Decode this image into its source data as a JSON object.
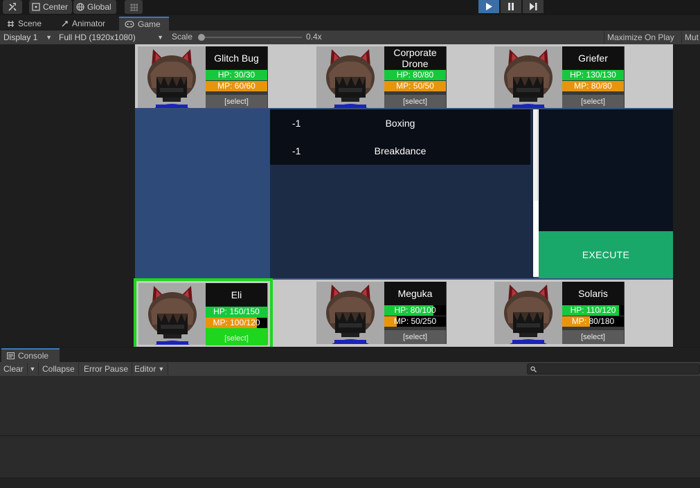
{
  "toolbar": {
    "center_label": "Center",
    "global_label": "Global"
  },
  "tabs": [
    {
      "label": "Scene"
    },
    {
      "label": "Animator"
    },
    {
      "label": "Game"
    }
  ],
  "gamebar": {
    "display": "Display 1",
    "resolution": "Full HD (1920x1080)",
    "scale_label": "Scale",
    "scale_value": "0.4x",
    "maximize": "Maximize On Play",
    "mute": "Mut"
  },
  "enemies": [
    {
      "name": "Glitch Bug",
      "hp": "HP: 30/30",
      "mp": "MP: 60/60",
      "hp_fill": 1.0,
      "mp_fill": 1.0,
      "select": "[select]"
    },
    {
      "name": "Corporate Drone",
      "hp": "HP: 80/80",
      "mp": "MP: 50/50",
      "hp_fill": 1.0,
      "mp_fill": 1.0,
      "select": "[select]"
    },
    {
      "name": "Griefer",
      "hp": "HP: 130/130",
      "mp": "MP: 80/80",
      "hp_fill": 1.0,
      "mp_fill": 1.0,
      "select": "[select]"
    }
  ],
  "players": [
    {
      "name": "Eli",
      "hp": "HP: 150/150",
      "mp": "MP: 100/120",
      "hp_fill": 1.0,
      "mp_fill": 0.833,
      "select": "[select]",
      "selected": true
    },
    {
      "name": "Meguka",
      "hp": "HP: 80/100",
      "mp": "MP: 50/250",
      "hp_fill": 0.8,
      "mp_fill": 0.2,
      "select": "[select]",
      "selected": false
    },
    {
      "name": "Solaris",
      "hp": "HP: 110/120",
      "mp": "MP: 80/180",
      "hp_fill": 0.917,
      "mp_fill": 0.444,
      "select": "[select]",
      "selected": false
    }
  ],
  "skills": [
    {
      "cost": "-1",
      "name": "Boxing"
    },
    {
      "cost": "-1",
      "name": "Breakdance"
    }
  ],
  "execute_label": "EXECUTE",
  "console": {
    "tab_label": "Console",
    "clear": "Clear",
    "collapse": "Collapse",
    "error_pause": "Error Pause",
    "editor": "Editor"
  },
  "colors": {
    "hp": "#17c83c",
    "mp": "#e8950c",
    "selected": "#1ed61e",
    "execute": "#1aa86a"
  }
}
